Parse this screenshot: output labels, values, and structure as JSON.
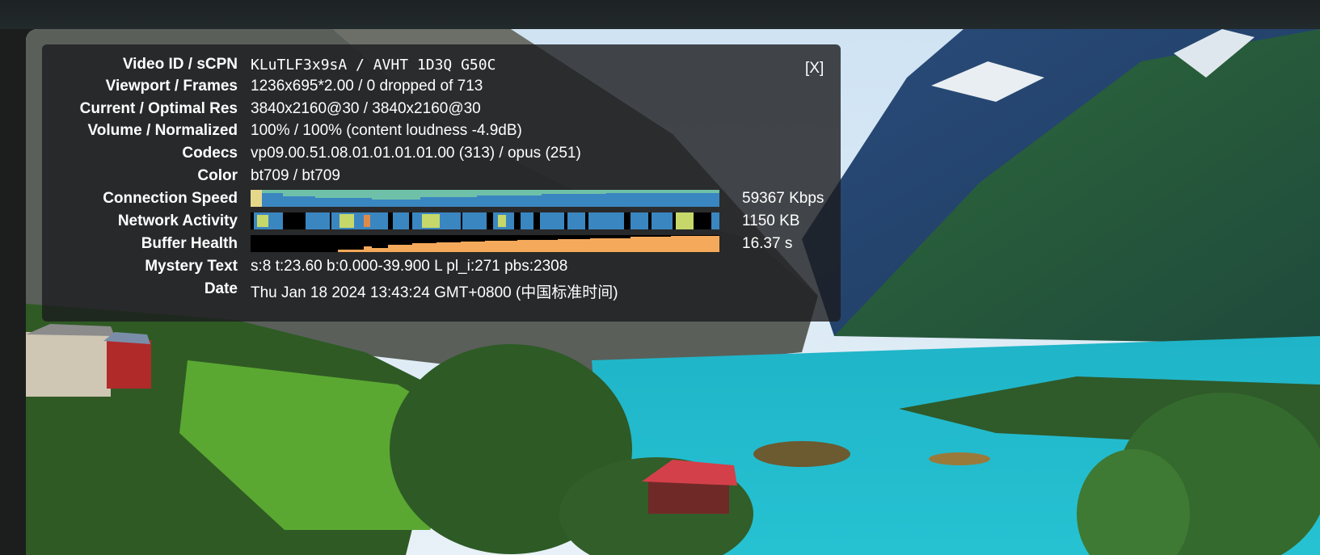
{
  "stats": {
    "close_label": "[X]",
    "rows": [
      {
        "label": "Video ID / sCPN",
        "value": "KLuTLF3x9sA / AVHT 1D3Q G50C"
      },
      {
        "label": "Viewport / Frames",
        "value": "1236x695*2.00 / 0 dropped of 713"
      },
      {
        "label": "Current / Optimal Res",
        "value": "3840x2160@30 / 3840x2160@30"
      },
      {
        "label": "Volume / Normalized",
        "value": "100% / 100% (content loudness -4.9dB)"
      },
      {
        "label": "Codecs",
        "value": "vp09.00.51.08.01.01.01.01.00 (313) / opus (251)"
      },
      {
        "label": "Color",
        "value": "bt709 / bt709"
      },
      {
        "label": "Connection Speed",
        "value": "59367 Kbps"
      },
      {
        "label": "Network Activity",
        "value": "1150 KB"
      },
      {
        "label": "Buffer Health",
        "value": "16.37 s"
      },
      {
        "label": "Mystery Text",
        "value": "s:8 t:23.60 b:0.000-39.900 L pl_i:271 pbs:2308"
      },
      {
        "label": "Date",
        "value": "Thu Jan 18 2024 13:43:24 GMT+0800 (中国标准时间)"
      }
    ]
  },
  "colors": {
    "connection_speed": "#3a86c0",
    "connection_speed_light": "#6fc0a8",
    "network_activity_a": "#3a86c0",
    "network_activity_b": "#c6d86a",
    "buffer_health": "#f5a95a"
  }
}
